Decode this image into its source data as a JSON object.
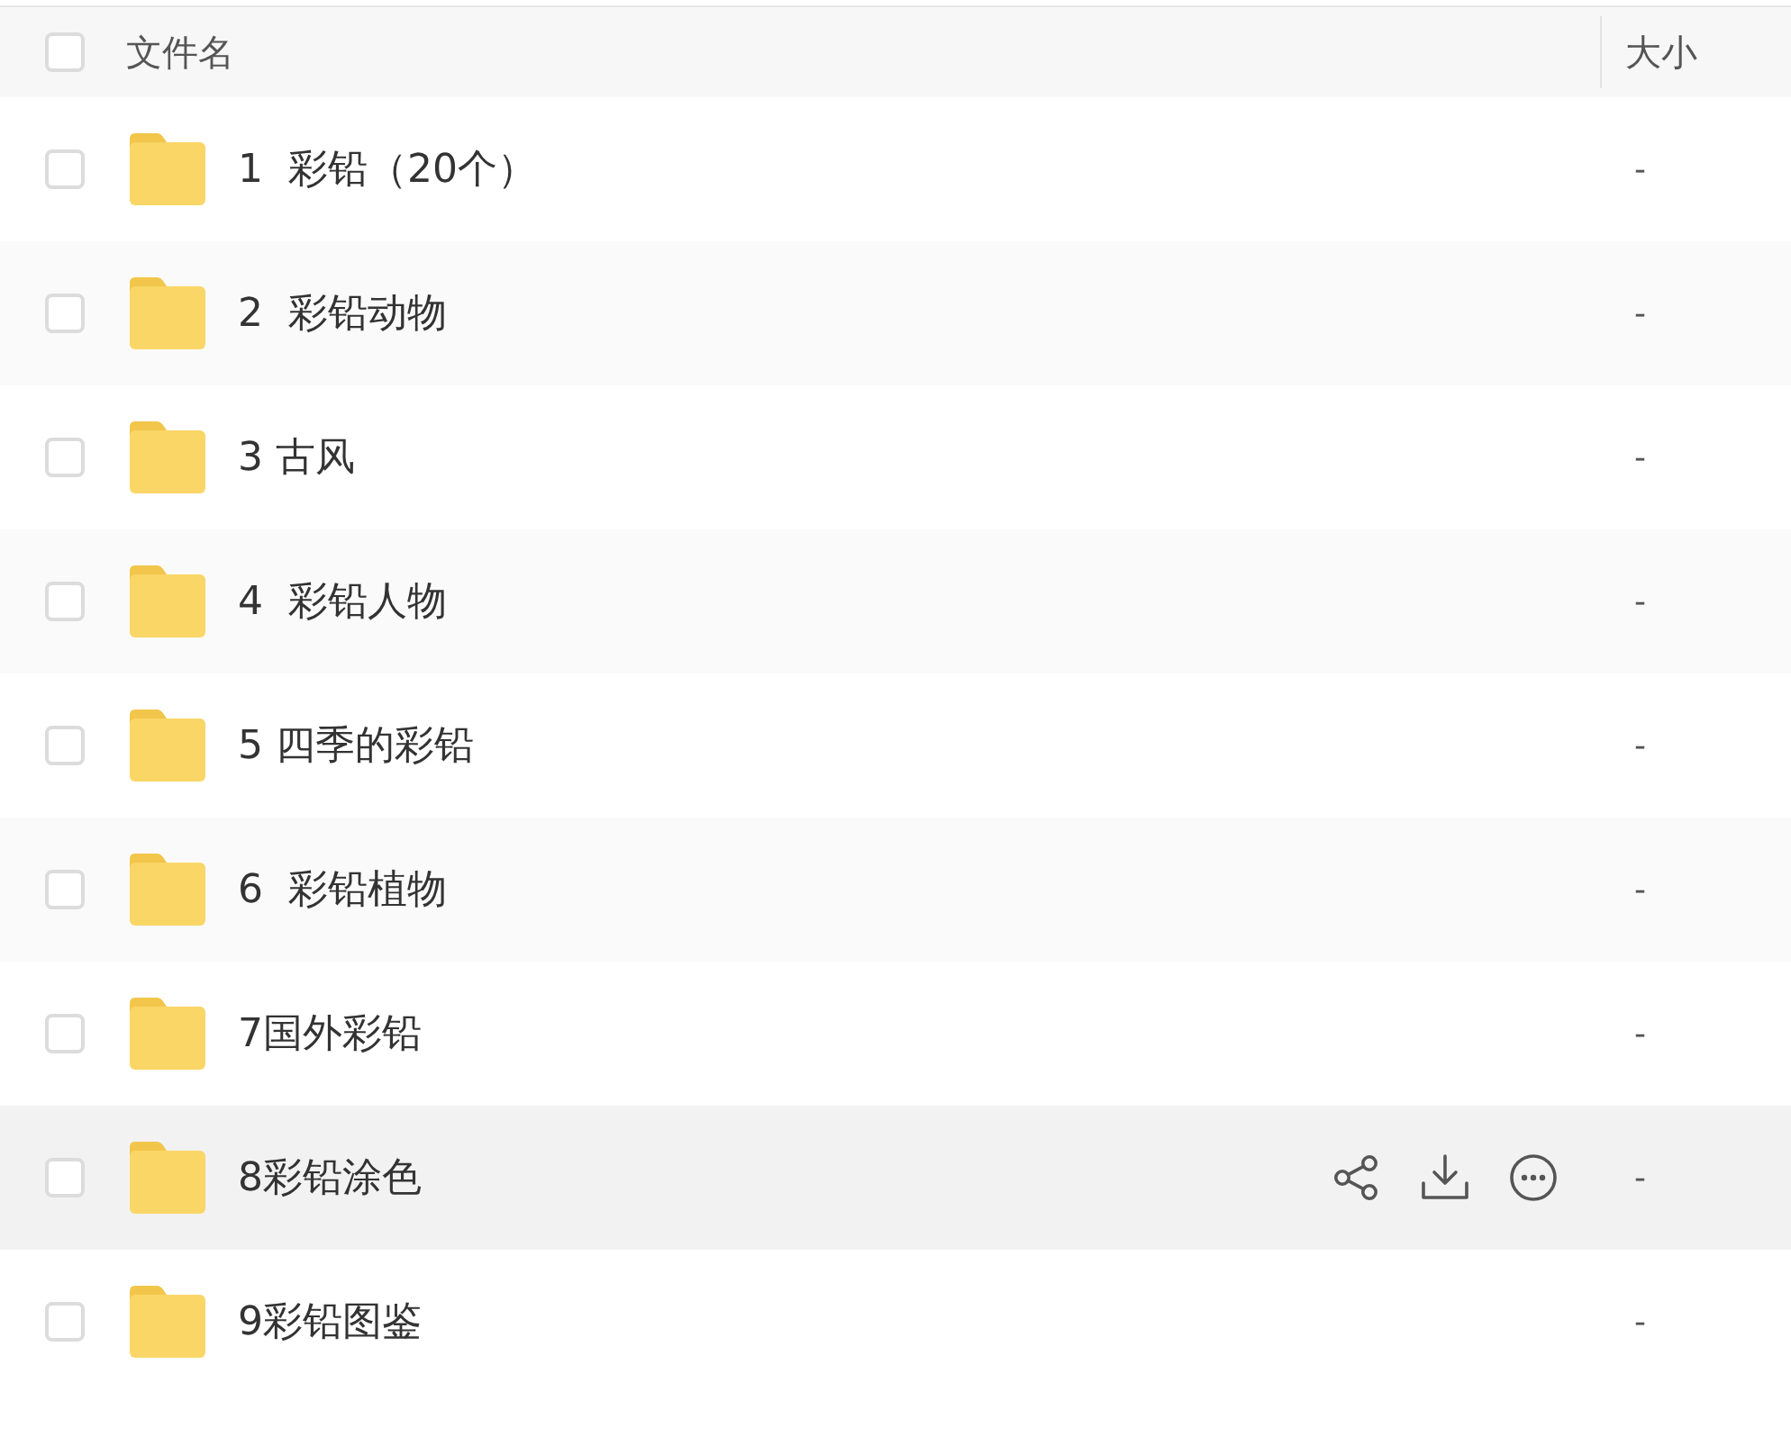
{
  "table": {
    "header": {
      "checked": false,
      "columns": [
        "文件名",
        "大小"
      ]
    },
    "rows": [
      {
        "name": "1  彩铅（20个）",
        "size": "-",
        "checked": false,
        "hovered": false
      },
      {
        "name": "2  彩铅动物",
        "size": "-",
        "checked": false,
        "hovered": false
      },
      {
        "name": "3 古风",
        "size": "-",
        "checked": false,
        "hovered": false
      },
      {
        "name": "4  彩铅人物",
        "size": "-",
        "checked": false,
        "hovered": false
      },
      {
        "name": "5 四季的彩铅",
        "size": "-",
        "checked": false,
        "hovered": false
      },
      {
        "name": "6  彩铅植物",
        "size": "-",
        "checked": false,
        "hovered": false
      },
      {
        "name": "7国外彩铅",
        "size": "-",
        "checked": false,
        "hovered": false
      },
      {
        "name": "8彩铅涂色",
        "size": "-",
        "checked": false,
        "hovered": true
      },
      {
        "name": "9彩铅图鉴",
        "size": "-",
        "checked": false,
        "hovered": false
      }
    ]
  }
}
